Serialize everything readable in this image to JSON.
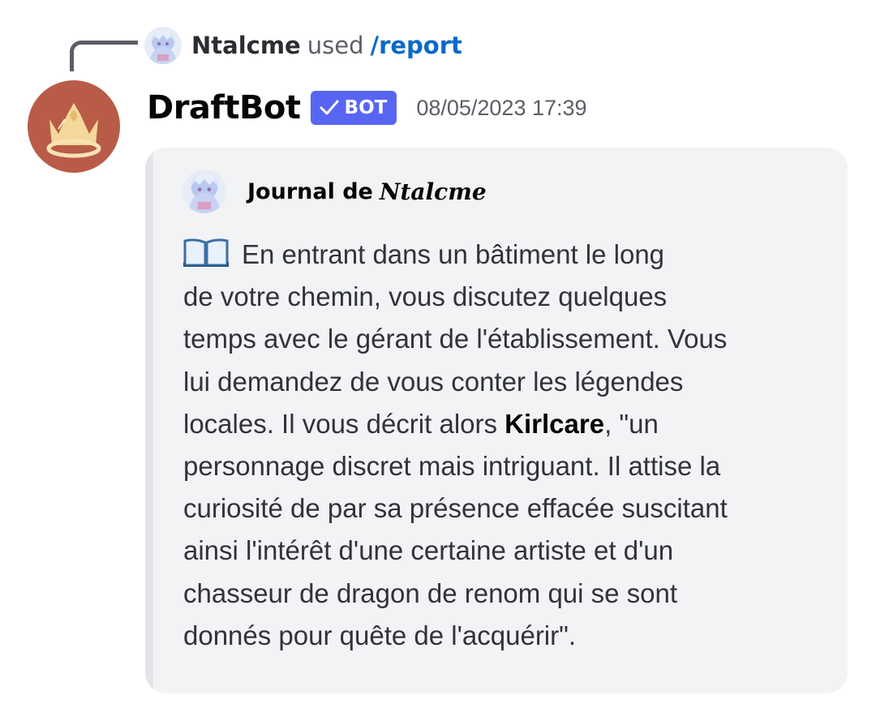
{
  "reply": {
    "username": "Ntalcme",
    "used_text": "used",
    "command": "/report"
  },
  "message": {
    "bot_name": "DraftBot",
    "badge_label": "BOT",
    "timestamp": "08/05/2023 17:39",
    "bot_avatar_icon": "crown-icon"
  },
  "embed": {
    "author_prefix": "Journal de",
    "author_name": "Ntalcme",
    "description_icon": "open-book-icon",
    "description": {
      "line1": "En entrant dans un bâtiment le long",
      "line2": "de votre chemin, vous discutez quelques",
      "line3": "temps avec le gérant de l'établissement. Vous",
      "line4": "lui demandez de vous conter les légendes",
      "line5_pre": "locales. Il vous décrit alors ",
      "line5_bold": "Kirlcare",
      "line5_post": ", \"un",
      "line6": "personnage discret mais intriguant. Il attise la",
      "line7": "curiosité de par sa présence effacée suscitant",
      "line8": "ainsi l'intérêt d'une certaine artiste et d'un",
      "line9": "chasseur de dragon de renom qui se sont",
      "line10": "donnés pour quête de l'acquérir\"."
    }
  },
  "colors": {
    "badge": "#5865f2",
    "command_link": "#0b69c7",
    "bot_avatar_bg": "#b85c48",
    "embed_bg": "#f2f3f5"
  }
}
